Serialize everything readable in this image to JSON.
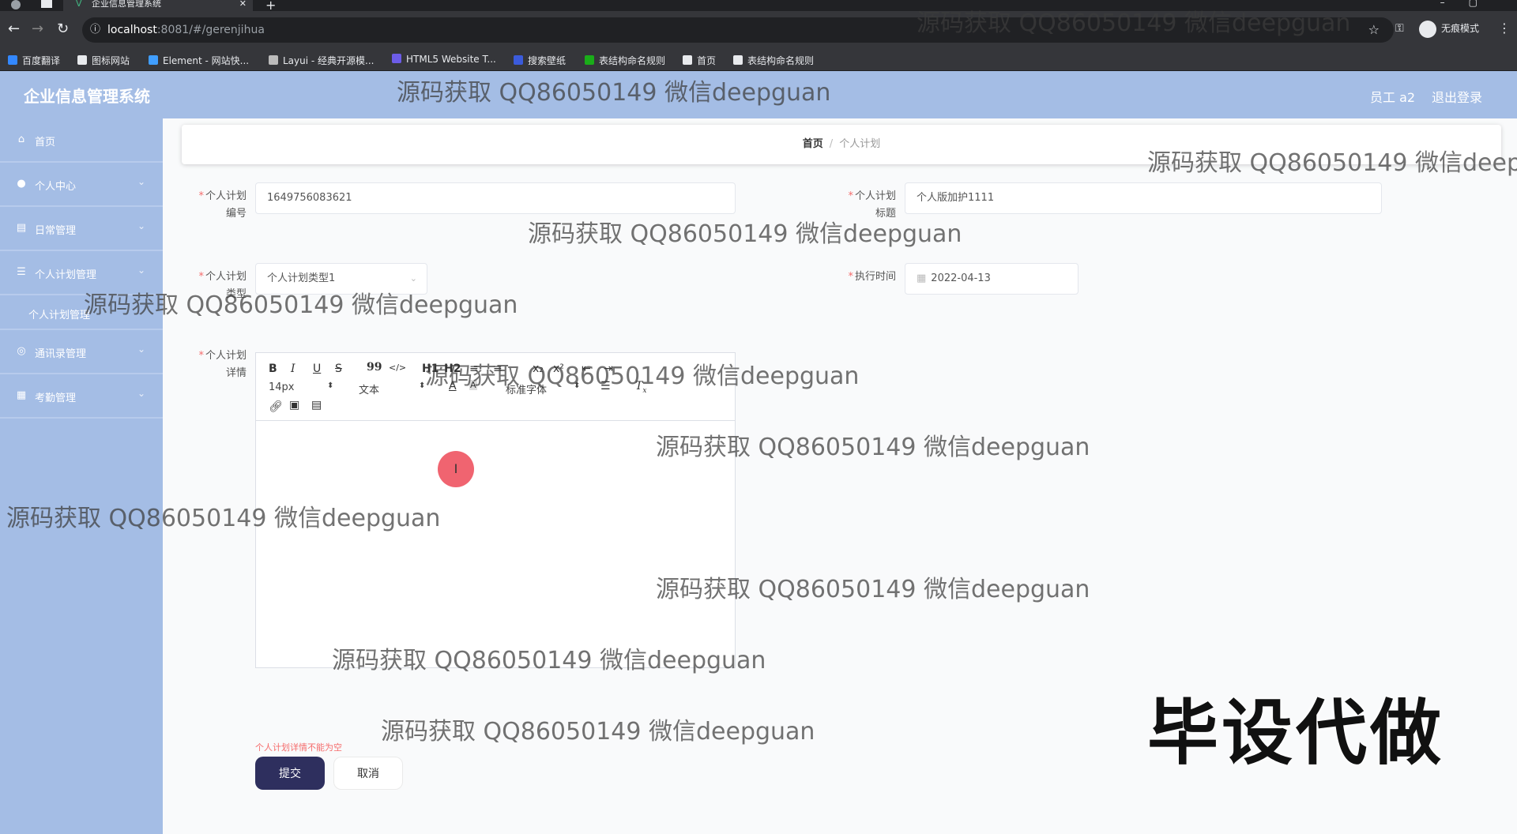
{
  "browser": {
    "tab_title": "企业信息管理系统",
    "tab_close": "✕",
    "new_tab": "+",
    "url_host": "localhost",
    "url_rest": ":8081/#/gerenjihua",
    "incognito_label": "无痕模式",
    "bookmarks": [
      {
        "label": "百度翻译",
        "color": "#3388ff"
      },
      {
        "label": "图标网站",
        "color": "#e8eaed"
      },
      {
        "label": "Element - 网站快...",
        "color": "#409eff"
      },
      {
        "label": "Layui - 经典开源模...",
        "color": "#bbbbbb"
      },
      {
        "label": "HTML5 Website T...",
        "color": "#6c5ce7"
      },
      {
        "label": "搜索壁纸",
        "color": "#3b5bdb"
      },
      {
        "label": "表结构命名规则",
        "color": "#1aad19"
      },
      {
        "label": "首页",
        "color": "#e8eaed"
      },
      {
        "label": "表结构命名规则",
        "color": "#e8eaed"
      }
    ]
  },
  "header": {
    "title": "企业信息管理系统",
    "user": "员工 a2",
    "logout": "退出登录"
  },
  "sidebar": {
    "items": [
      {
        "label": "首页",
        "icon": "home-icon",
        "glyph": "⌂"
      },
      {
        "label": "个人中心",
        "icon": "user-icon",
        "glyph": "●"
      },
      {
        "label": "日常管理",
        "icon": "calendar-icon",
        "glyph": "▤"
      },
      {
        "label": "个人计划管理",
        "icon": "list-icon",
        "glyph": "☰"
      },
      {
        "label": "通讯录管理",
        "icon": "contacts-icon",
        "glyph": "◎"
      },
      {
        "label": "考勤管理",
        "icon": "grid-icon",
        "glyph": "▦"
      }
    ],
    "sub_item": "个人计划管理",
    "chevron": "⌄"
  },
  "breadcrumb": {
    "home": "首页",
    "separator": "/",
    "current": "个人计划"
  },
  "form": {
    "plan_no_label_1": "个人计划",
    "plan_no_label_2": "编号",
    "plan_no_value": "1649756083621",
    "plan_title_label_1": "个人计划",
    "plan_title_label_2": "标题",
    "plan_title_value": "个人版加护1111",
    "plan_type_label_1": "个人计划",
    "plan_type_label_2": "类型",
    "plan_type_value": "个人计划类型1",
    "exec_time_label": "执行时间",
    "exec_time_value": "2022-04-13",
    "detail_label_1": "个人计划",
    "detail_label_2": "详情",
    "required_mark": "*",
    "error": "个人计划详情不能为空",
    "submit": "提交",
    "cancel": "取消"
  },
  "editor": {
    "toolbar_row1": [
      "B",
      "I",
      "U",
      "S",
      "99",
      "</>",
      "H1",
      "H2",
      "≡",
      "≡",
      "x₂",
      "x²",
      "⇤",
      "⇥"
    ],
    "font_size": "14px",
    "text_style": "文本",
    "font_family": "标准字体",
    "cursor": "I"
  },
  "watermark_text": "源码获取 QQ86050149 微信deepguan",
  "stamp_text": "毕设代做"
}
